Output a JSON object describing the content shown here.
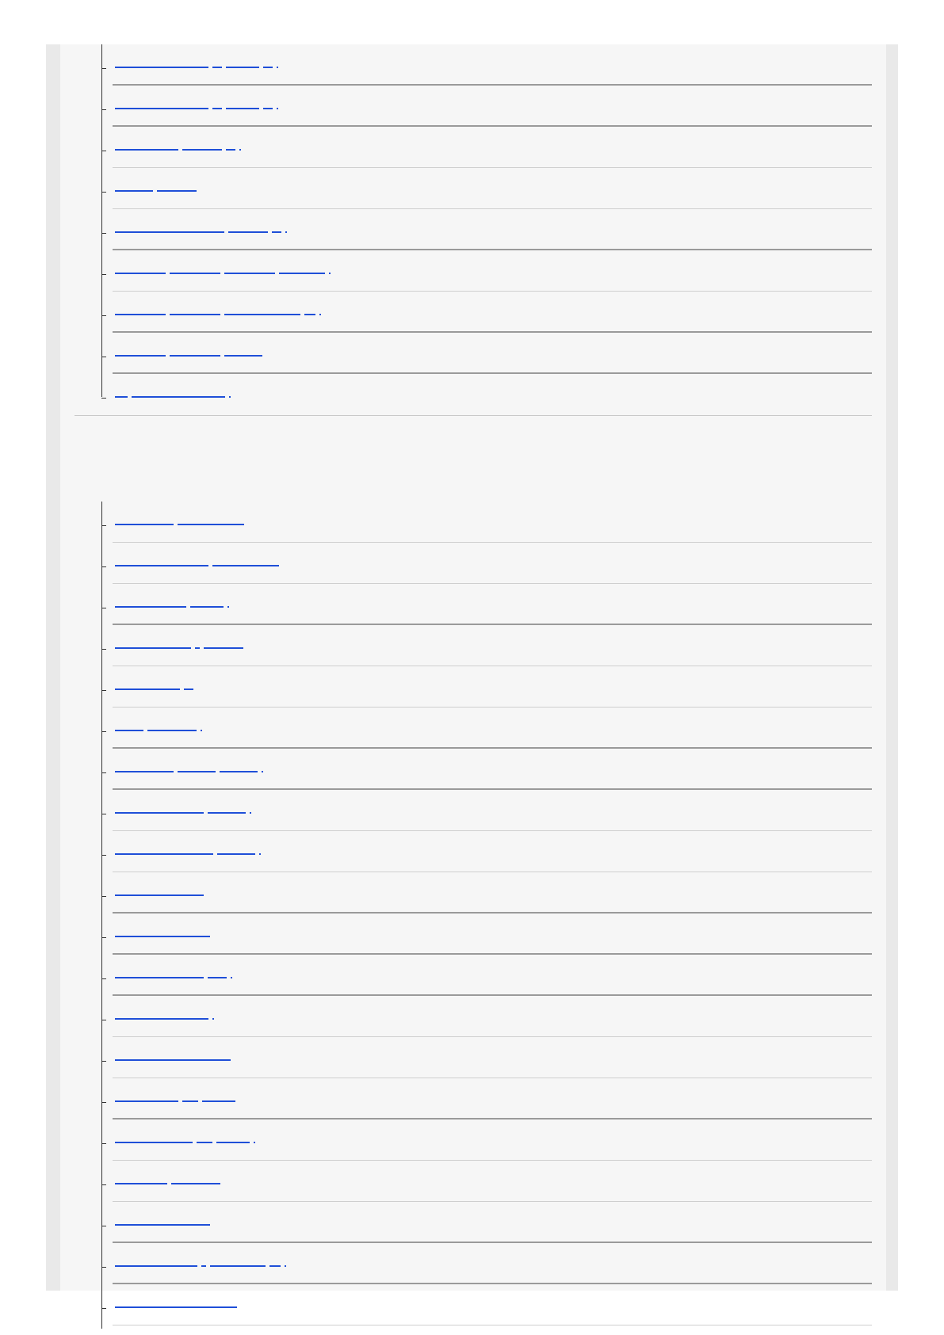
{
  "section_one": {
    "items": [
      {
        "label": "",
        "link_widths": [
          118,
          12,
          42,
          12
        ],
        "dot": true,
        "dark_rule": true
      },
      {
        "label": "",
        "link_widths": [
          118,
          12,
          42,
          12
        ],
        "dot": true,
        "dark_rule": true
      },
      {
        "label": "",
        "link_widths": [
          80,
          50,
          12
        ],
        "dot": true,
        "dark_rule": false
      },
      {
        "label": "",
        "link_widths": [
          48,
          50
        ],
        "dot": false,
        "dark_rule": false
      },
      {
        "label": "",
        "link_widths": [
          138,
          50,
          12
        ],
        "dot": true,
        "dark_rule": true
      },
      {
        "label": "",
        "link_widths": [
          64,
          64,
          64,
          58
        ],
        "dot": true,
        "dark_rule": false
      },
      {
        "label": "",
        "link_widths": [
          64,
          64,
          96,
          14
        ],
        "dot": true,
        "dark_rule": true
      },
      {
        "label": "",
        "link_widths": [
          64,
          64,
          48
        ],
        "dot": false,
        "dark_rule": true
      },
      {
        "label": "",
        "link_widths": [
          16,
          118
        ],
        "dot": true,
        "dark_rule": false
      }
    ]
  },
  "section_two": {
    "items": [
      {
        "label": "",
        "link_widths": [
          74,
          84
        ],
        "dot": false,
        "dark_rule": false
      },
      {
        "label": "",
        "link_widths": [
          118,
          84
        ],
        "dot": false,
        "dark_rule": false
      },
      {
        "label": "",
        "link_widths": [
          90,
          42
        ],
        "dot": true,
        "dark_rule": true
      },
      {
        "label": "",
        "link_widths": [
          96,
          6,
          50
        ],
        "dot": false,
        "dark_rule": false
      },
      {
        "label": "",
        "link_widths": [
          82,
          12
        ],
        "dot": false,
        "dark_rule": false
      },
      {
        "label": "",
        "link_widths": [
          36,
          62
        ],
        "dot": true,
        "dark_rule": true
      },
      {
        "label": "",
        "link_widths": [
          74,
          48,
          48
        ],
        "dot": true,
        "dark_rule": true
      },
      {
        "label": "",
        "link_widths": [
          112,
          48
        ],
        "dot": true,
        "dark_rule": false
      },
      {
        "label": "",
        "link_widths": [
          124,
          48
        ],
        "dot": true,
        "dark_rule": false
      },
      {
        "label": "",
        "link_widths": [
          112
        ],
        "dot": false,
        "dark_rule": true
      },
      {
        "label": "",
        "link_widths": [
          120
        ],
        "dot": false,
        "dark_rule": true
      },
      {
        "label": "",
        "link_widths": [
          112,
          24
        ],
        "dot": true,
        "dark_rule": true
      },
      {
        "label": "",
        "link_widths": [
          118
        ],
        "dot": true,
        "dark_rule": false
      },
      {
        "label": "",
        "link_widths": [
          146
        ],
        "dot": false,
        "dark_rule": false
      },
      {
        "label": "",
        "link_widths": [
          80,
          20,
          42
        ],
        "dot": false,
        "dark_rule": true
      },
      {
        "label": "",
        "link_widths": [
          98,
          20,
          42
        ],
        "dot": true,
        "dark_rule": false
      },
      {
        "label": "",
        "link_widths": [
          66,
          62
        ],
        "dot": false,
        "dark_rule": false
      },
      {
        "label": "",
        "link_widths": [
          120
        ],
        "dot": false,
        "dark_rule": true
      },
      {
        "label": "",
        "link_widths": [
          104,
          6,
          70,
          14
        ],
        "dot": true,
        "dark_rule": true
      },
      {
        "label": "",
        "link_widths": [
          154
        ],
        "dot": false,
        "dark_rule": false
      }
    ]
  }
}
